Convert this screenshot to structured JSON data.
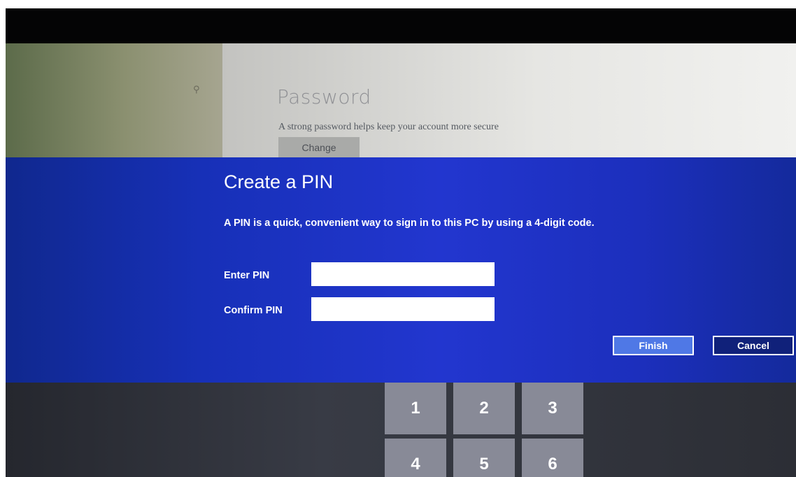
{
  "settings": {
    "section_title": "Password",
    "section_description": "A strong password helps keep your account more secure",
    "change_label": "Change"
  },
  "dialog": {
    "title": "Create a PIN",
    "description": "A PIN is a quick, convenient way to sign in to this PC by using a 4-digit code.",
    "enter_pin_label": "Enter PIN",
    "enter_pin_value": "",
    "confirm_pin_label": "Confirm PIN",
    "confirm_pin_value": "",
    "finish_label": "Finish",
    "cancel_label": "Cancel"
  },
  "keypad": {
    "keys": [
      "1",
      "2",
      "3",
      "4",
      "5",
      "6"
    ]
  },
  "colors": {
    "dialog_blue": "#1d33c4",
    "finish_button": "#4f78e6",
    "cancel_button": "#10217a",
    "key_gray": "#888a97"
  },
  "icons": {
    "search": "search-icon"
  }
}
